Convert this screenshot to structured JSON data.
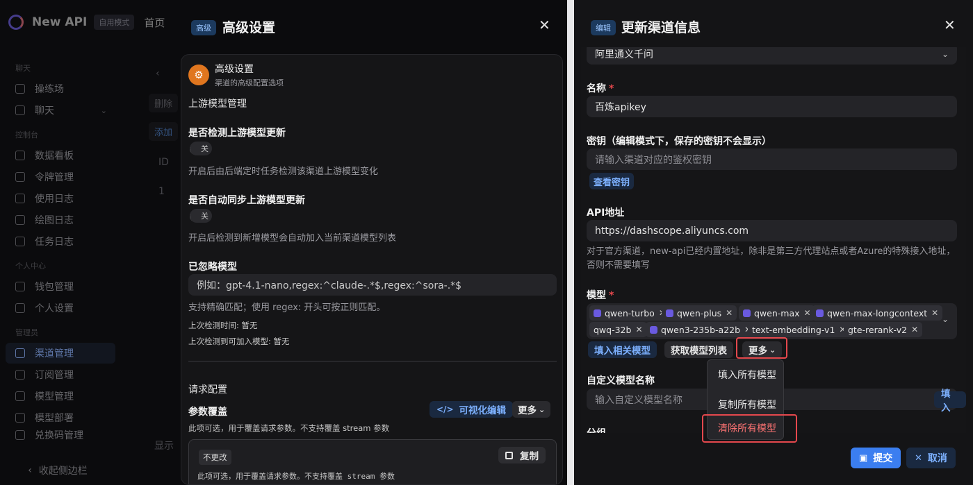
{
  "app": {
    "name": "New API",
    "mode": "自用模式",
    "home": "首页"
  },
  "sidebar": {
    "groups": [
      {
        "label": "聊天",
        "items": [
          "操练场",
          "聊天"
        ]
      },
      {
        "label": "控制台",
        "items": [
          "数据看板",
          "令牌管理",
          "使用日志",
          "绘图日志",
          "任务日志"
        ]
      },
      {
        "label": "个人中心",
        "items": [
          "钱包管理",
          "个人设置"
        ]
      },
      {
        "label": "管理员",
        "items": [
          "渠道管理",
          "订阅管理",
          "模型管理",
          "模型部署",
          "兑换码管理"
        ]
      }
    ],
    "collapse": "收起侧边栏"
  },
  "background": {
    "delete_btn": "删除",
    "add_btn": "添加",
    "col_id": "ID",
    "row_id": "1",
    "show_text": "显示"
  },
  "advanced": {
    "badge": "高级",
    "title": "高级设置",
    "card_title": "高级设置",
    "card_sub": "渠道的高级配置选项",
    "upstream_section": "上游模型管理",
    "detect_label": "是否检测上游模型更新",
    "detect_toggle": "关",
    "detect_help": "开启后由后端定时任务检测该渠道上游模型变化",
    "autosync_label": "是否自动同步上游模型更新",
    "autosync_toggle": "关",
    "autosync_help": "开启后检测到新增模型会自动加入当前渠道模型列表",
    "ignored_label": "已忽略模型",
    "ignored_placeholder": "例如：gpt-4.1-nano,regex:^claude-.*$,regex:^sora-.*$",
    "ignored_help": "支持精确匹配；使用 regex: 开头可按正则匹配。",
    "last_check_time": "上次检测时间: 暂无",
    "last_check_models": "上次检测到可加入模型: 暂无",
    "request_section": "请求配置",
    "param_label": "参数覆盖",
    "visual_edit": "可视化编辑",
    "more": "更多",
    "param_help": "此项可选，用于覆盖请求参数。不支持覆盖 stream 参数",
    "no_change_tag": "不更改",
    "copy_btn": "复制",
    "code_text": "此项可选，用于覆盖请求参数。不支持覆盖 stream 参数"
  },
  "channel": {
    "badge": "编辑",
    "title": "更新渠道信息",
    "type_value": "阿里通义千问",
    "name_label": "名称",
    "name_value": "百炼apikey",
    "key_label": "密钥（编辑模式下，保存的密钥不会显示）",
    "key_placeholder": "请输入渠道对应的鉴权密钥",
    "view_key": "查看密钥",
    "api_label": "API地址",
    "api_value": "https://dashscope.aliyuncs.com",
    "api_help": "对于官方渠道，new-api已经内置地址，除非是第三方代理站点或者Azure的特殊接入地址，否则不需要填写",
    "models_label": "模型",
    "models": [
      "qwen-turbo",
      "qwen-plus",
      "qwen-max",
      "qwen-max-longcontext",
      "qwq-32b",
      "qwen3-235b-a22b",
      "text-embedding-v1",
      "gte-rerank-v2"
    ],
    "fill_related": "填入相关模型",
    "fetch_list": "获取模型列表",
    "more": "更多",
    "dropdown": [
      "填入所有模型",
      "复制所有模型",
      "清除所有模型"
    ],
    "custom_label": "自定义模型名称",
    "custom_placeholder": "输入自定义模型名称",
    "fill_btn": "填入",
    "group_label": "分组",
    "submit": "提交",
    "cancel": "取消"
  },
  "colors": {
    "accent": "#3b7ef0",
    "danger": "#e5484d",
    "badge_bg": "#1c3a5e"
  }
}
